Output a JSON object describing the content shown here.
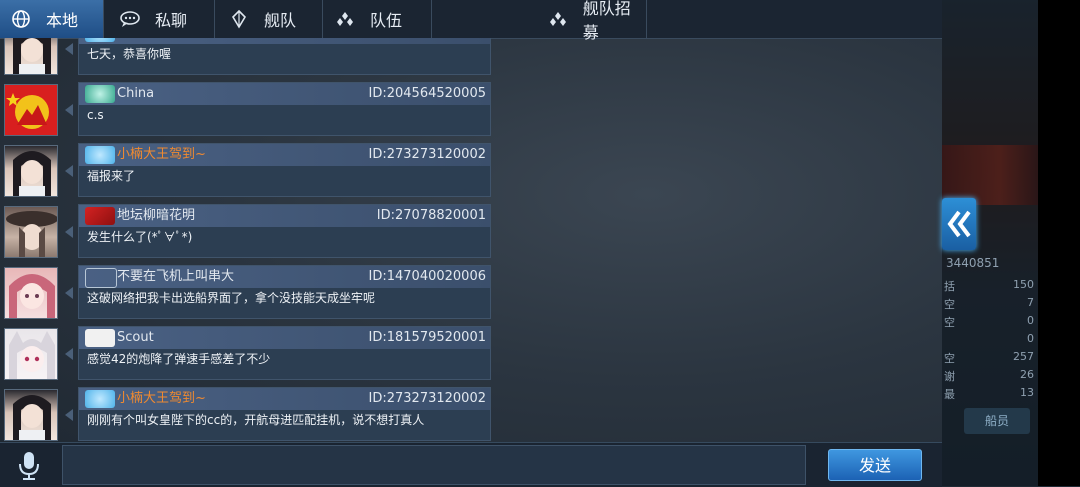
{
  "tabs": [
    {
      "label": "本地",
      "icon": "globe-icon",
      "active": true
    },
    {
      "label": "私聊",
      "icon": "chat-bubble-icon",
      "active": false
    },
    {
      "label": "舰队",
      "icon": "fleet-icon",
      "active": false
    },
    {
      "label": "队伍",
      "icon": "team-icon",
      "active": false
    },
    {
      "label": "舰队招募",
      "icon": "recruit-icon",
      "active": false
    }
  ],
  "messages": [
    {
      "name": "",
      "id": "",
      "text": "七天，恭喜你喔",
      "name_color": "#f08a30",
      "avatar": "anime-girl-dark-hair"
    },
    {
      "name": "China",
      "id": "ID:204564520005",
      "text": "c.s",
      "name_color": "#e2e8ef",
      "avatar": "red-flag-emblem"
    },
    {
      "name": "小楠大王驾到~",
      "id": "ID:273273120002",
      "text": "福报来了",
      "name_color": "#f08a30",
      "avatar": "anime-girl-dark-hair"
    },
    {
      "name": "地坛柳暗花明",
      "id": "ID:27078820001",
      "text": "发生什么了(*ﾟ∀ﾟ*)",
      "name_color": "#e2e8ef",
      "avatar": "anime-girl-hat"
    },
    {
      "name": "不要在飞机上叫串大",
      "id": "ID:147040020006",
      "text": "这破网络把我卡出选船界面了，拿个没技能天成坐牢呢",
      "name_color": "#e2e8ef",
      "avatar": "anime-girl-pink-hair"
    },
    {
      "name": "Scout",
      "id": "ID:181579520001",
      "text": "感觉42的炮降了弹速手感差了不少",
      "name_color": "#e2e8ef",
      "avatar": "anime-girl-white-hair"
    },
    {
      "name": "小楠大王驾到~",
      "id": "ID:273273120002",
      "text": "刚刚有个叫女皇陛下的cc的，开航母进匹配挂机，说不想打真人",
      "name_color": "#f08a30",
      "avatar": "anime-girl-dark-hair"
    }
  ],
  "input": {
    "value": ""
  },
  "send_label": "发送",
  "side_panel": {
    "id_text": "3440851",
    "rows": [
      {
        "label": "括",
        "value": "150"
      },
      {
        "label": "空",
        "value": "7"
      },
      {
        "label": "空",
        "value": "0"
      },
      {
        "label": "",
        "value": "0"
      },
      {
        "label": "空",
        "value": "257"
      },
      {
        "label": "谢",
        "value": "26"
      },
      {
        "label": "最",
        "value": "13"
      }
    ],
    "crew_label": "船员"
  }
}
